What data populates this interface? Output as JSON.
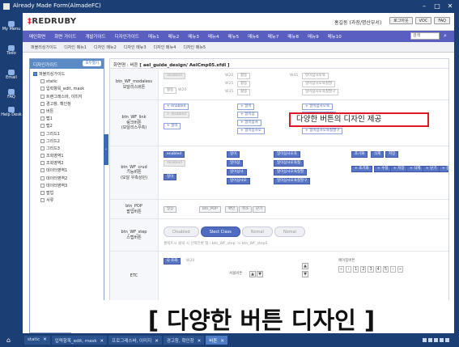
{
  "window": {
    "title": "Already Made Form(AlmadeFC)",
    "controls": [
      "–",
      "□",
      "✕"
    ]
  },
  "leftbar": [
    {
      "label": "My Menu",
      "icon": "person-icon"
    },
    {
      "label": "Todo",
      "icon": "clipboard-icon"
    },
    {
      "label": "Email",
      "icon": "mail-icon"
    },
    {
      "label": "FAQ",
      "icon": "question-icon"
    },
    {
      "label": "Help Desk",
      "icon": "headset-icon"
    }
  ],
  "header": {
    "logo": "REDRUBY",
    "logo_mark": "‡",
    "user": "홍길동 (과장/명산부서)",
    "buttons": [
      "로그아웃",
      "VOC",
      "FAQ"
    ]
  },
  "gnb": {
    "items": [
      "메인화면",
      "화면 가이드",
      "개발가이드",
      "디자인가이드",
      "메뉴1",
      "메뉴2",
      "메뉴3",
      "메뉴4",
      "메뉴5",
      "메뉴6",
      "메뉴7",
      "메뉴8",
      "메뉴9",
      "메뉴10"
    ],
    "search_placeholder": "검색"
  },
  "subnav": {
    "items": [
      "퍼블리싱가이드",
      "디자인 메뉴1",
      "디자인 메뉴2",
      "디자인 메뉴3",
      "디자인 메뉴4",
      "디자인 메뉴5"
    ]
  },
  "tree": {
    "title": "디자인가이드",
    "button": "모두열기",
    "items": [
      {
        "label": "퍼블리싱가이드",
        "level": 0
      },
      {
        "label": "static",
        "level": 1
      },
      {
        "label": "입력항목_edit, mask",
        "level": 1
      },
      {
        "label": "트랜그래스바, 이미지",
        "level": 1
      },
      {
        "label": "경고창, 확인창",
        "level": 1
      },
      {
        "label": "버튼",
        "level": 1
      },
      {
        "label": "탭1",
        "level": 1
      },
      {
        "label": "탭2",
        "level": 1
      },
      {
        "label": "그리드1",
        "level": 1
      },
      {
        "label": "그리드2",
        "level": 1
      },
      {
        "label": "그리드3",
        "level": 1
      },
      {
        "label": "조회영역1",
        "level": 1
      },
      {
        "label": "조회영역2",
        "level": 1
      },
      {
        "label": "데이터영역1",
        "level": 1
      },
      {
        "label": "데이터영역2",
        "level": 1
      },
      {
        "label": "데이터영역3",
        "level": 1
      },
      {
        "label": "팝업",
        "level": 1
      },
      {
        "label": "서류",
        "level": 1
      }
    ],
    "collapse_label": "메뉴 숨기기"
  },
  "content": {
    "path_prefix": "화면명 : 버튼",
    "path_file": "[ aeI_guide_design/ AeICmp05.xfdl ]",
    "callout": "다양한 버튼의 디자인 제공",
    "rows": {
      "modaless": {
        "name": "btn_WF_modaless",
        "desc": "모달리스버튼",
        "btn_disabled": "disabled",
        "btn_a": "활동",
        "btn_b": "활동",
        "link1": "활동",
        "link2": "일이삼사오육",
        "link3": "일이삼사오육칠팔",
        "link4": "일이삼사오육칠팔구",
        "w20": "W20",
        "w25": "W25",
        "w35": "W35",
        "w45": "W45",
        "small_btn": "활동",
        "small_txt": "W20"
      },
      "link": {
        "name": "btn_WF_link",
        "desc1": "링크버튼",
        "desc2": "(모달리스우측)",
        "enabled": "+ enabled",
        "disabled": "+ disabled",
        "plus": "+ 일이",
        "plus2": "+ 일이삼",
        "plus3": "+ 일이삼사",
        "plus4": "+ 일이삼사오",
        "plus_long1": "+ 일이삼사오육",
        "plus_long2": "+ 일이삼사오육칠",
        "plus_long3": "+ 일이삼사오육칠팔",
        "plus_long4": "+ 일이삼사오육칠팔구",
        "small_btn": "+ 일이"
      },
      "crud": {
        "name": "btn_WF_crud",
        "desc1": "기능버튼",
        "desc2": "(모달 우측상단)",
        "enabled": "enabled",
        "disabled": "disabled",
        "b1": "일이",
        "b2": "일이삼",
        "b3": "일이삼사",
        "b4": "일이삼사오",
        "l1": "일이삼사오육",
        "l2": "일이삼사오육칠",
        "l3": "일이삼사오육칠팔",
        "l4": "일이삼사오육칠팔구",
        "act1": "조기화",
        "act2": "삭제",
        "act3": "저장",
        "icons": [
          "+ 조기화",
          "+ 수정",
          "+ 저장",
          "+ 삭제",
          "+ 닫기",
          "+ 등록"
        ],
        "small": "일이"
      },
      "pop": {
        "name": "btn_POP",
        "desc": "팝업버튼",
        "btns": [
          "일상",
          "btn_POP",
          "확인",
          "취소",
          "닫기"
        ]
      },
      "step": {
        "name": "btn_WF_step",
        "desc": "스텝버튼",
        "items": [
          "Disabled",
          "Slect Class",
          "Nomal",
          "Nomal"
        ],
        "note": "셀렉트시 클릭 시 선택전환 탭 : btn_WF_step -> btn_WF_stepS"
      },
      "etc": {
        "name": "ETC",
        "search_btn": "Q 조회",
        "search_lbl": "W20",
        "spin_lbl": "서울버튼",
        "paging_lbl": "페이징버튼",
        "pages": [
          "«",
          "‹",
          "1",
          "2",
          "3",
          "4",
          "5",
          "›",
          "»"
        ]
      }
    }
  },
  "overlay": "[ 다양한 버튼 디자인 ]",
  "taskbar": {
    "home_icon": "home-icon",
    "tabs": [
      "static",
      "입력항목_edit, mask",
      "프로그레스바, 이미지",
      "경고창, 확인창",
      "버튼"
    ]
  }
}
